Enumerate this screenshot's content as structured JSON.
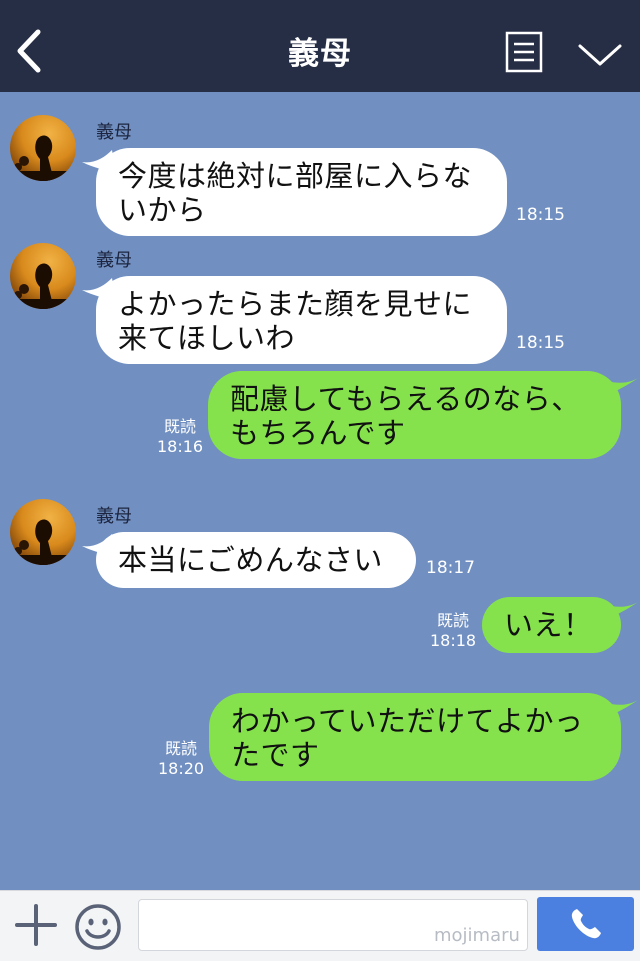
{
  "header": {
    "title": "義母",
    "back_icon": "chevron-left-icon",
    "menu_icon": "list-icon",
    "collapse_icon": "chevron-down-icon"
  },
  "messages": [
    {
      "direction": "in",
      "sender": "義母",
      "text": "今度は絶対に部屋に入らな\nいから",
      "time": "18:15"
    },
    {
      "direction": "in",
      "sender": "義母",
      "text": "よかったらまた顔を見せに\n来てほしいわ",
      "time": "18:15"
    },
    {
      "direction": "out",
      "read": "既読",
      "text": "配慮してもらえるのなら、\nもちろんです",
      "time": "18:16"
    },
    {
      "direction": "in",
      "sender": "義母",
      "text": "本当にごめんなさい",
      "time": "18:17"
    },
    {
      "direction": "out",
      "read": "既読",
      "text": "いえ！",
      "time": "18:18"
    },
    {
      "direction": "out",
      "read": "既読",
      "text": "わかっていただけてよかっ\nたです",
      "time": "18:20"
    }
  ],
  "footer": {
    "plus_icon": "plus-icon",
    "emoji_icon": "smiley-icon",
    "input_value": "",
    "watermark": "mojimaru",
    "call_icon": "phone-icon"
  },
  "colors": {
    "header_bg": "#262e45",
    "chat_bg": "#7190c1",
    "incoming_bubble": "#ffffff",
    "outgoing_bubble": "#86e24c",
    "call_button": "#4b7fe0"
  }
}
